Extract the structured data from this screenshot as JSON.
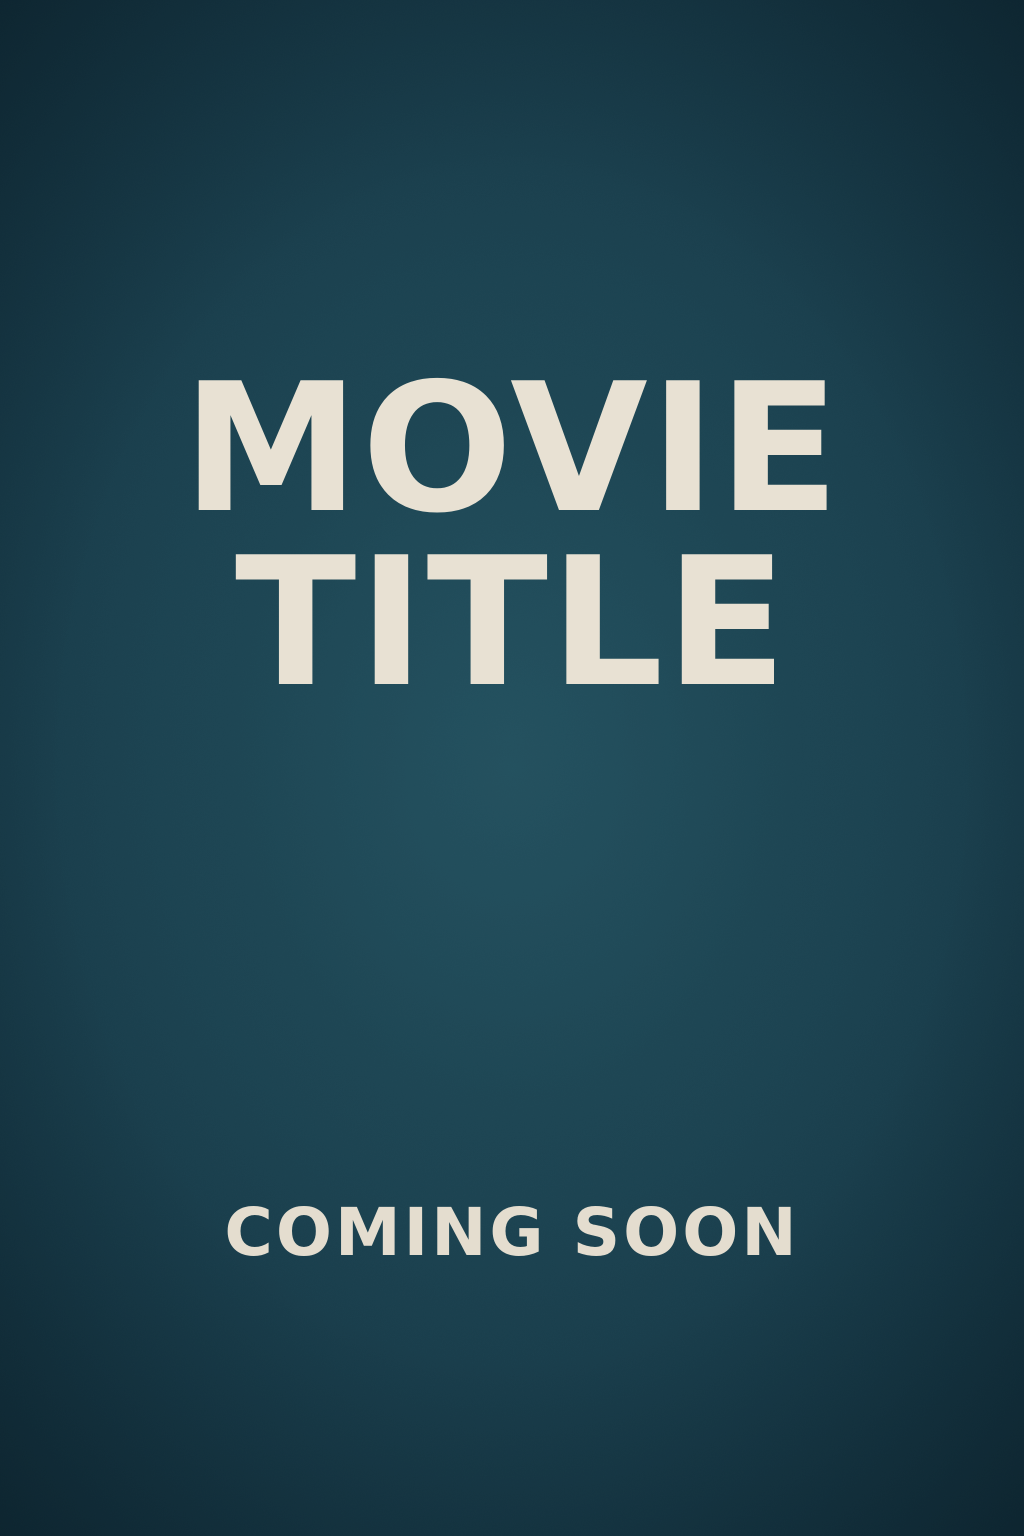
{
  "poster": {
    "title_line_1": "MOVIE",
    "title_line_2": "TITLE",
    "tagline": "COMING SOON"
  },
  "colors": {
    "background": "#1b4250",
    "text": "#e8e1d3"
  }
}
